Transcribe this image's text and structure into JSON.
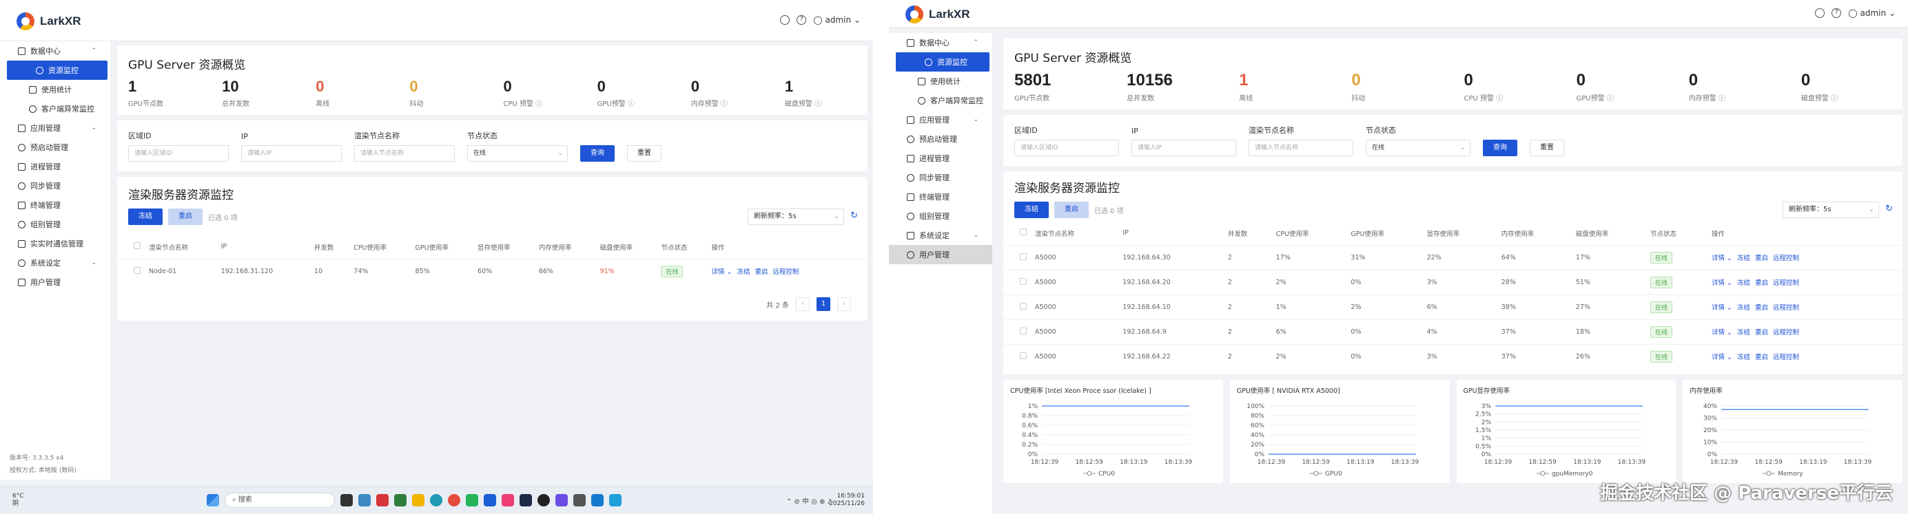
{
  "brand": "LarkXR",
  "user": "admin",
  "left": {
    "sidebar": [
      {
        "label": "数据中心",
        "type": "group",
        "arrow": "⌃"
      },
      {
        "label": "资源监控",
        "type": "child",
        "active": true
      },
      {
        "label": "使用统计",
        "type": "child"
      },
      {
        "label": "客户端异常监控",
        "type": "child"
      },
      {
        "label": "应用管理",
        "type": "group",
        "arrow": "⌄"
      },
      {
        "label": "预启动管理",
        "type": "group"
      },
      {
        "label": "进程管理",
        "type": "group"
      },
      {
        "label": "同步管理",
        "type": "group"
      },
      {
        "label": "终端管理",
        "type": "group"
      },
      {
        "label": "组别管理",
        "type": "group"
      },
      {
        "label": "实实时通信管理",
        "type": "group"
      },
      {
        "label": "系统设定",
        "type": "group",
        "arrow": "⌄"
      },
      {
        "label": "用户管理",
        "type": "group"
      }
    ],
    "version": "版本号: 3.3.3.5 x4",
    "auth": "授权方式: 本地版 (数码)",
    "overview_title": "GPU Server 资源概览",
    "stats": [
      {
        "num": "1",
        "label": "GPU节点数",
        "color": "normal"
      },
      {
        "num": "10",
        "label": "总并发数",
        "color": "normal"
      },
      {
        "num": "0",
        "label": "离线",
        "color": "red"
      },
      {
        "num": "0",
        "label": "抖动",
        "color": "orange"
      },
      {
        "num": "0",
        "label": "CPU 预警 ⓘ",
        "color": "normal"
      },
      {
        "num": "0",
        "label": "GPU预警 ⓘ",
        "color": "normal"
      },
      {
        "num": "0",
        "label": "内存预警 ⓘ",
        "color": "normal"
      },
      {
        "num": "1",
        "label": "磁盘预警 ⓘ",
        "color": "normal"
      }
    ],
    "filters": {
      "region_label": "区域ID",
      "region_ph": "请输入区域ID",
      "ip_label": "IP",
      "ip_ph": "请输入IP",
      "name_label": "渲染节点名称",
      "name_ph": "请输入节点名称",
      "status_label": "节点状态",
      "status_val": "在线",
      "query": "查询",
      "reset": "重置"
    },
    "monitor_title": "渲染服务器资源监控",
    "freeze": "冻结",
    "unfreeze": "重启",
    "selected": "已选 0 项",
    "refresh": "刷新频率：5s",
    "columns": [
      "渲染节点名称",
      "IP",
      "并发数",
      "CPU使用率",
      "GPU使用率",
      "显存使用率",
      "内存使用率",
      "磁盘使用率",
      "节点状态",
      "操作"
    ],
    "rows": [
      {
        "name": "Node-01",
        "ip": "192.168.31.120",
        "conc": "10",
        "cpu": "74%",
        "gpu": "85%",
        "vram": "60%",
        "mem": "66%",
        "disk": "91%",
        "status": "在线"
      }
    ],
    "ops": [
      "详情 ⌄",
      "冻结",
      "重启",
      "远程控制"
    ],
    "total": "共 2 条",
    "page": "1",
    "taskbar": {
      "temp": "6°C",
      "weather": "阴",
      "search": "搜索",
      "time": "16:59:01",
      "date": "2025/11/26"
    }
  },
  "right": {
    "sidebar": [
      {
        "label": "数据中心",
        "type": "group",
        "arrow": "⌃"
      },
      {
        "label": "资源监控",
        "type": "child",
        "active": true
      },
      {
        "label": "使用统计",
        "type": "child"
      },
      {
        "label": "客户端异常监控",
        "type": "child"
      },
      {
        "label": "应用管理",
        "type": "group",
        "arrow": "⌄"
      },
      {
        "label": "预启动管理",
        "type": "group"
      },
      {
        "label": "进程管理",
        "type": "group"
      },
      {
        "label": "同步管理",
        "type": "group"
      },
      {
        "label": "终端管理",
        "type": "group"
      },
      {
        "label": "组别管理",
        "type": "group"
      },
      {
        "label": "系统设定",
        "type": "group",
        "arrow": "⌄"
      },
      {
        "label": "用户管理",
        "type": "group",
        "gray": true
      }
    ],
    "overview_title": "GPU Server 资源概览",
    "stats": [
      {
        "num": "5801",
        "label": "GPU节点数",
        "color": "normal"
      },
      {
        "num": "10156",
        "label": "总并发数",
        "color": "normal"
      },
      {
        "num": "1",
        "label": "离线",
        "color": "red"
      },
      {
        "num": "0",
        "label": "抖动",
        "color": "orange"
      },
      {
        "num": "0",
        "label": "CPU 预警 ⓘ",
        "color": "normal"
      },
      {
        "num": "0",
        "label": "GPU预警 ⓘ",
        "color": "normal"
      },
      {
        "num": "0",
        "label": "内存预警 ⓘ",
        "color": "normal"
      },
      {
        "num": "0",
        "label": "磁盘预警 ⓘ",
        "color": "normal"
      }
    ],
    "filters": {
      "region_label": "区域ID",
      "region_ph": "请输入区域ID",
      "ip_label": "IP",
      "ip_ph": "请输入IP",
      "name_label": "渲染节点名称",
      "name_ph": "请输入节点名称",
      "status_label": "节点状态",
      "status_val": "在线",
      "query": "查询",
      "reset": "重置"
    },
    "monitor_title": "渲染服务器资源监控",
    "freeze": "冻结",
    "unfreeze": "重启",
    "selected": "已选 0 项",
    "refresh": "刷新频率：5s",
    "columns": [
      "渲染节点名称",
      "IP",
      "并发数",
      "CPU使用率",
      "GPU使用率",
      "显存使用率",
      "内存使用率",
      "磁盘使用率",
      "节点状态",
      "操作"
    ],
    "rows": [
      {
        "name": "A5000",
        "ip": "192.168.64.30",
        "conc": "2",
        "cpu": "17%",
        "gpu": "31%",
        "vram": "22%",
        "mem": "64%",
        "disk": "17%",
        "status": "在线"
      },
      {
        "name": "A5000",
        "ip": "192.168.64.20",
        "conc": "2",
        "cpu": "2%",
        "gpu": "0%",
        "vram": "3%",
        "mem": "28%",
        "disk": "51%",
        "status": "在线"
      },
      {
        "name": "A5000",
        "ip": "192.168.64.10",
        "conc": "2",
        "cpu": "1%",
        "gpu": "2%",
        "vram": "6%",
        "mem": "38%",
        "disk": "27%",
        "status": "在线"
      },
      {
        "name": "A5000",
        "ip": "192.168.64.9",
        "conc": "2",
        "cpu": "6%",
        "gpu": "0%",
        "vram": "4%",
        "mem": "37%",
        "disk": "18%",
        "status": "在线"
      },
      {
        "name": "A5000",
        "ip": "192.168.64.22",
        "conc": "2",
        "cpu": "2%",
        "gpu": "0%",
        "vram": "3%",
        "mem": "37%",
        "disk": "26%",
        "status": "在线"
      }
    ],
    "ops": [
      "详情 ⌄",
      "冻结",
      "重启",
      "远程控制"
    ],
    "watermark": "掘金技术社区 @ Paraverse平行云"
  },
  "chart_data": [
    {
      "type": "line",
      "title": "CPU使用率 [Intel Xeon Proce ssor (Icelake) ]",
      "categories": [
        "18:12:39",
        "18:12:59",
        "18:13:19",
        "18:13:39"
      ],
      "series": [
        {
          "name": "CPU0",
          "values": [
            1,
            1,
            1,
            1
          ]
        }
      ],
      "yticks": [
        "1%",
        "0.8%",
        "0.6%",
        "0.4%",
        "0.2%",
        "0%"
      ],
      "ylim": [
        0,
        1
      ]
    },
    {
      "type": "line",
      "title": "GPU使用率 [ NVIDIA RTX A5000]",
      "categories": [
        "18:12:39",
        "18:12:59",
        "18:13:19",
        "18:13:39"
      ],
      "series": [
        {
          "name": "GPU0",
          "values": [
            0,
            0,
            0,
            0
          ]
        }
      ],
      "yticks": [
        "100%",
        "80%",
        "60%",
        "40%",
        "20%",
        "0%"
      ],
      "ylim": [
        0,
        100
      ]
    },
    {
      "type": "line",
      "title": "GPU显存使用率",
      "categories": [
        "18:12:39",
        "18:12:59",
        "18:13:19",
        "18:13:39"
      ],
      "series": [
        {
          "name": "gpuMemory0",
          "values": [
            3,
            3,
            3,
            3
          ]
        }
      ],
      "yticks": [
        "3%",
        "2.5%",
        "2%",
        "1.5%",
        "1%",
        "0.5%",
        "0%"
      ],
      "ylim": [
        0,
        3
      ]
    },
    {
      "type": "line",
      "title": "内存使用率",
      "categories": [
        "18:12:39",
        "18:12:59",
        "18:13:19",
        "18:13:39"
      ],
      "series": [
        {
          "name": "Memory",
          "values": [
            37,
            37,
            37,
            37
          ]
        }
      ],
      "yticks": [
        "40%",
        "30%",
        "20%",
        "10%",
        "0%"
      ],
      "ylim": [
        0,
        40
      ]
    }
  ]
}
